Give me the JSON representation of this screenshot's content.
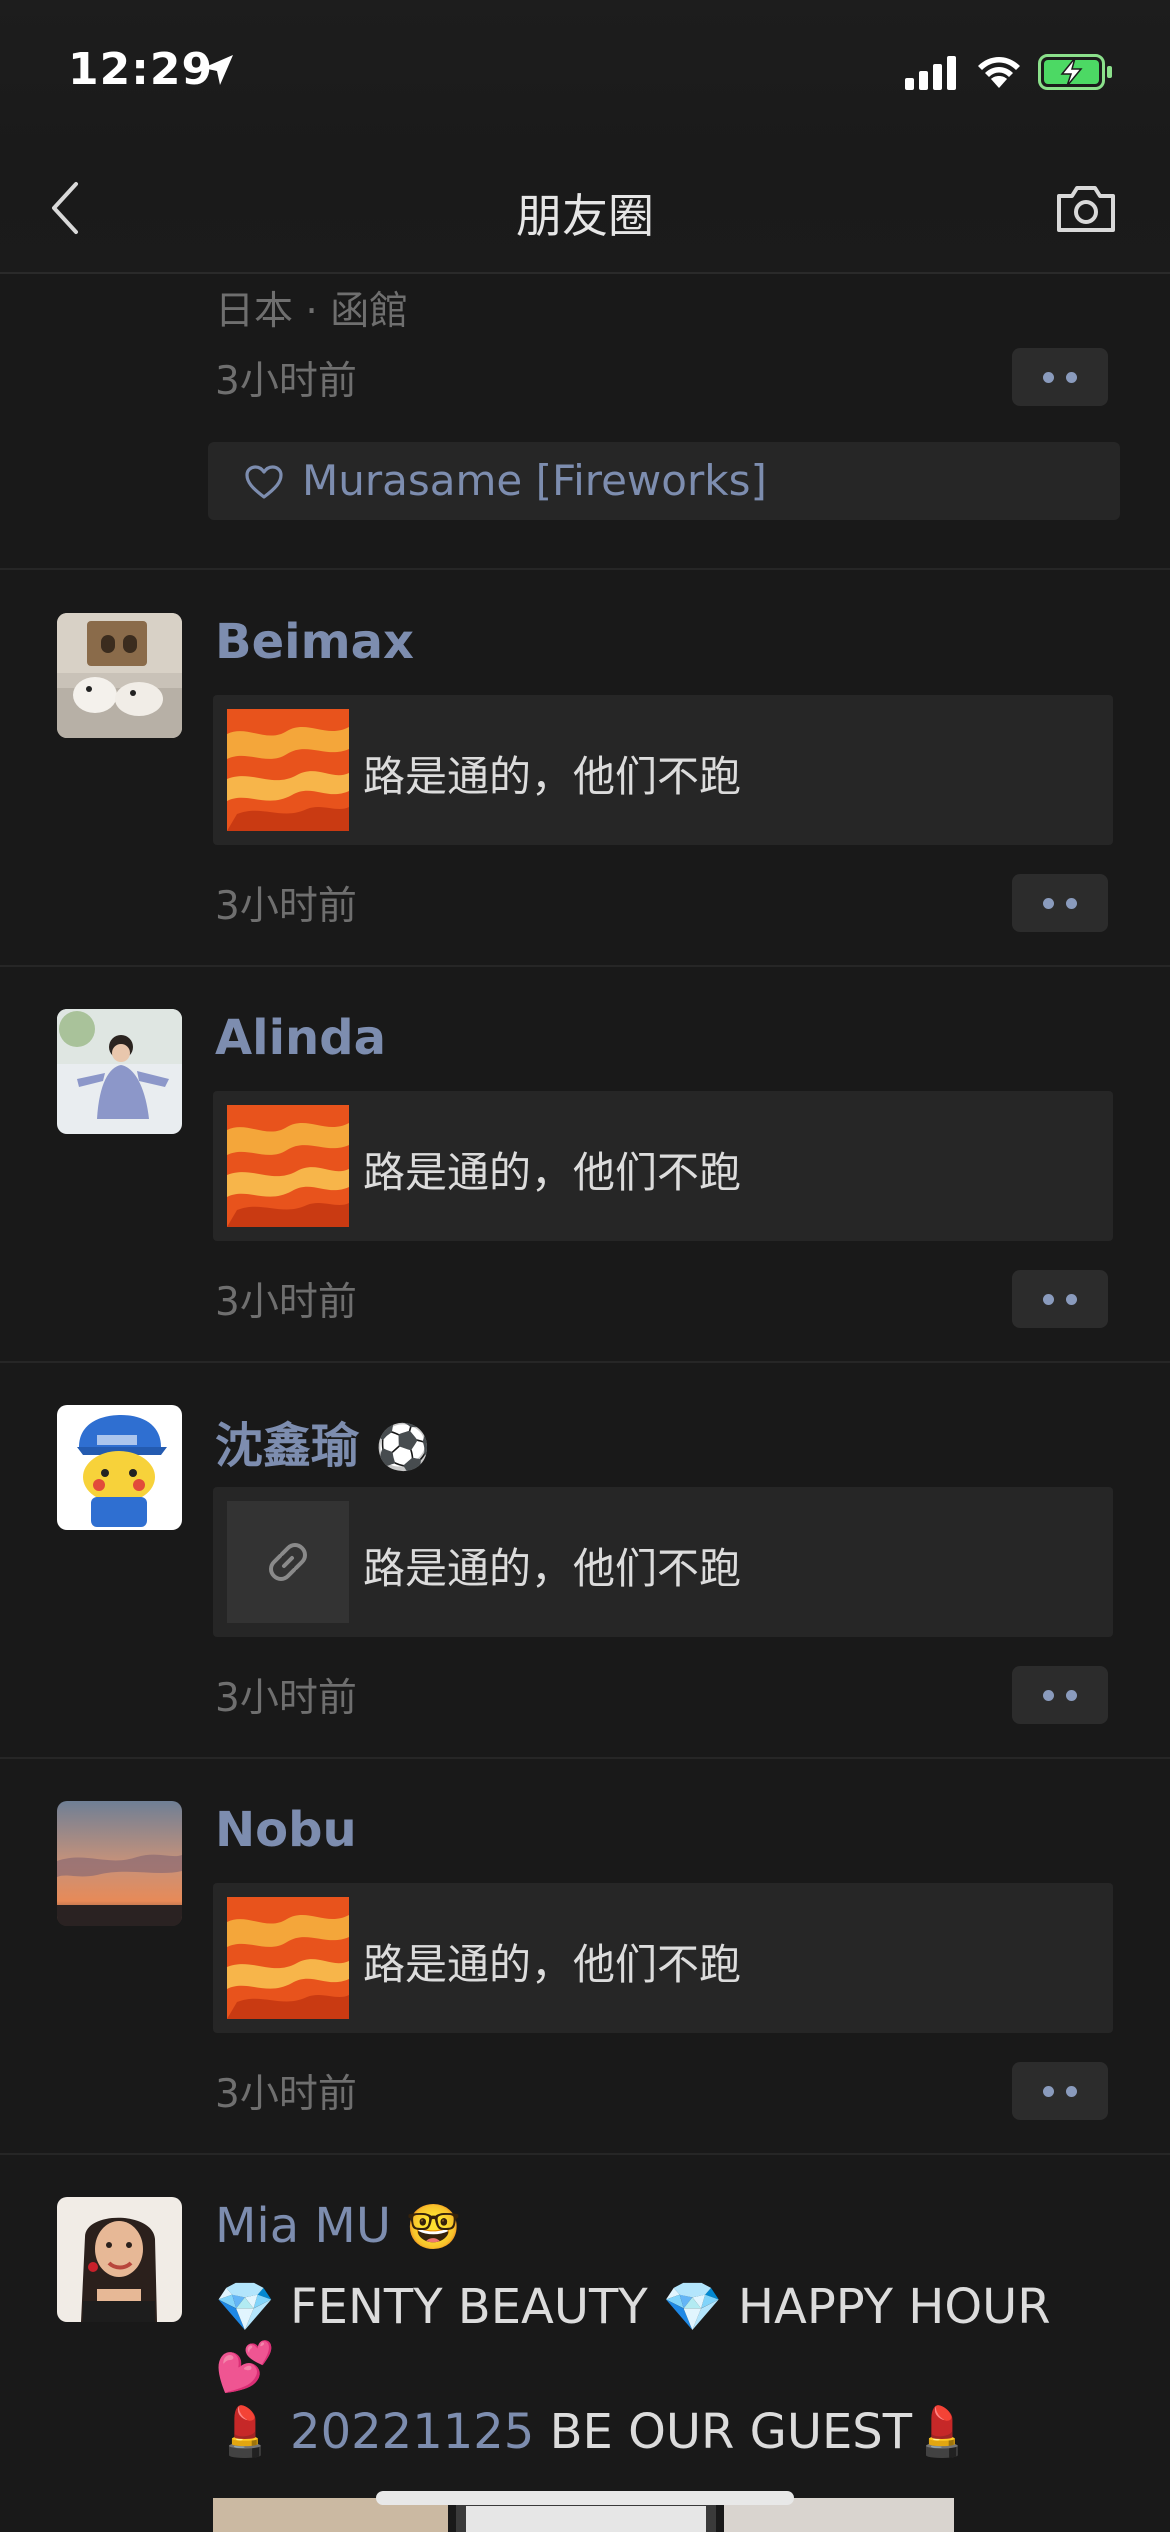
{
  "status_bar": {
    "time": "12:29"
  },
  "nav": {
    "title": "朋友圈"
  },
  "prev_post": {
    "location": "日本 · 函館",
    "time": "3小时前",
    "like_name": "Murasame [Fireworks]"
  },
  "posts": [
    {
      "name": "Beimax",
      "share_title": "路是通的，他们不跑",
      "time": "3小时前",
      "thumb": "orange-art"
    },
    {
      "name": "Alinda",
      "share_title": "路是通的，他们不跑",
      "time": "3小时前",
      "thumb": "orange-art"
    },
    {
      "name": "沈鑫瑜",
      "name_emoji": "⚽",
      "share_title": "路是通的，他们不跑",
      "time": "3小时前",
      "thumb": "link-icon"
    },
    {
      "name": "Nobu",
      "share_title": "路是通的，他们不跑",
      "time": "3小时前",
      "thumb": "orange-art"
    }
  ],
  "last_post": {
    "name": "Mia MU",
    "name_emoji": "🤓",
    "line1": "💎 FENTY BEAUTY 💎 HAPPY HOUR",
    "line2": "💕",
    "line3_emoji_start": "💄",
    "line3_date": "20221125",
    "line3_text": " BE OUR GUEST",
    "line3_emoji_end": "💄"
  },
  "colors": {
    "background": "#191919",
    "name_link": "#7d8daf",
    "meta_text": "#6f6f6f",
    "card": "#262626"
  }
}
